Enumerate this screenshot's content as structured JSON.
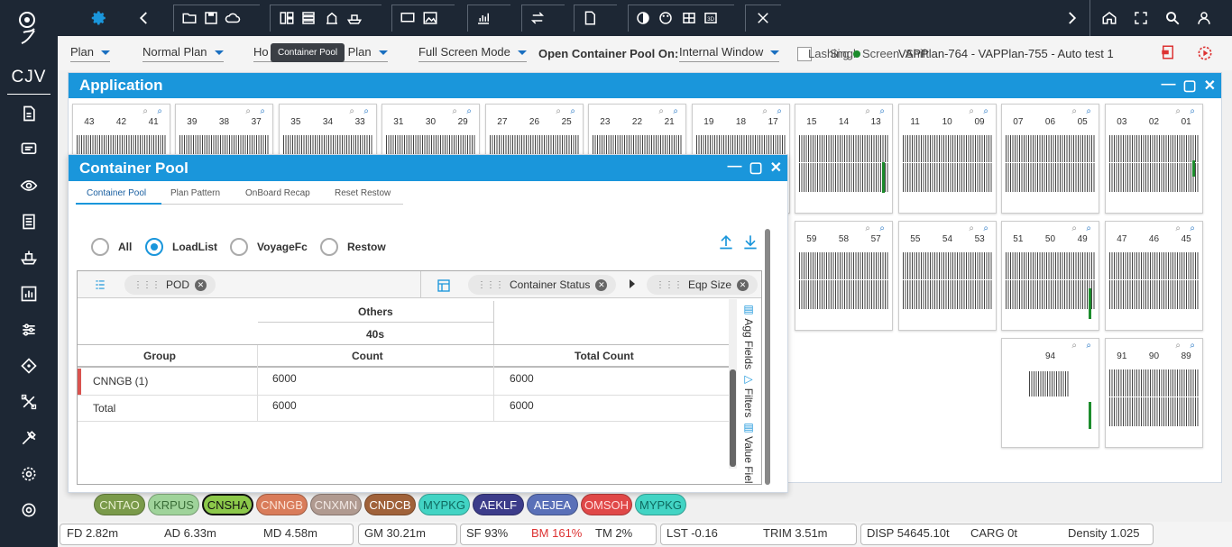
{
  "nav": {
    "brand": "CJV"
  },
  "toolbar": {
    "plan": "Plan",
    "plan_type": "Normal Plan",
    "hold_prefix": "Ho",
    "plan_suffix": "Plan",
    "screen_mode": "Full Screen Mode",
    "open_pool_label": "Open Container Pool On:",
    "open_pool_value": "Internal Window",
    "lashing_text": "Lashing",
    "single_text": "Singl",
    "screen_text": "Screen",
    "shift_text": "Shift",
    "voyage_info": "VAPPlan-764 - VAPPlan-755 - Auto test 1",
    "tooltip": "Container Pool"
  },
  "app": {
    "title": "Application"
  },
  "bays_top": [
    {
      "nums": [
        "43",
        "42",
        "41"
      ]
    },
    {
      "nums": [
        "39",
        "38",
        "37"
      ]
    },
    {
      "nums": [
        "35",
        "34",
        "33"
      ]
    },
    {
      "nums": [
        "31",
        "30",
        "29"
      ]
    },
    {
      "nums": [
        "27",
        "26",
        "25"
      ]
    },
    {
      "nums": [
        "23",
        "22",
        "21"
      ]
    },
    {
      "nums": [
        "19",
        "18",
        "17"
      ]
    },
    {
      "nums": [
        "15",
        "14",
        "13"
      ]
    },
    {
      "nums": [
        "11",
        "10",
        "09"
      ]
    },
    {
      "nums": [
        "07",
        "06",
        "05"
      ]
    },
    {
      "nums": [
        "03",
        "02",
        "01"
      ]
    }
  ],
  "bays_mid": [
    {
      "nums": [
        "59",
        "58",
        "57"
      ]
    },
    {
      "nums": [
        "55",
        "54",
        "53"
      ]
    },
    {
      "nums": [
        "51",
        "50",
        "49"
      ]
    },
    {
      "nums": [
        "47",
        "46",
        "45"
      ]
    }
  ],
  "bays_bot": [
    {
      "nums": [
        "94"
      ]
    },
    {
      "nums": [
        "91",
        "90",
        "89"
      ]
    }
  ],
  "pool": {
    "title": "Container Pool",
    "tabs": [
      "Container Pool",
      "Plan Pattern",
      "OnBoard Recap",
      "Reset Restow"
    ],
    "radios": [
      "All",
      "LoadList",
      "VoyageFc",
      "Restow"
    ],
    "selected": "LoadList",
    "row_chip": "POD",
    "col_chips": [
      "Container Status",
      "Eqp Size"
    ],
    "col_group": "Others",
    "col_sub": "40s",
    "headers": [
      "Group",
      "Count",
      "Total Count"
    ],
    "rows": [
      {
        "group": "CNNGB (1)",
        "count": "6000",
        "total": "6000"
      },
      {
        "group": "Total",
        "count": "6000",
        "total": "6000"
      }
    ],
    "side_labels": [
      "Agg Fields",
      "Filters",
      "Value Fiel"
    ]
  },
  "ports": [
    {
      "code": "CNTAO",
      "bg": "#7a9a4a",
      "fg": "#e8f0d0"
    },
    {
      "code": "KRPUS",
      "bg": "#9fd39a",
      "fg": "#3a6e38"
    },
    {
      "code": "CNSHA",
      "bg": "#8cc84a",
      "fg": "#111111"
    },
    {
      "code": "CNNGB",
      "bg": "#d97c5a",
      "fg": "#fbe3d6"
    },
    {
      "code": "CNXMN",
      "bg": "#b09a90",
      "fg": "#f2e8e4"
    },
    {
      "code": "CNDCB",
      "bg": "#a0623a",
      "fg": "#ffffff"
    },
    {
      "code": "MYPKG",
      "bg": "#42d4c4",
      "fg": "#0e6a60"
    },
    {
      "code": "AEKLF",
      "bg": "#3c3c8a",
      "fg": "#ffffff"
    },
    {
      "code": "AEJEA",
      "bg": "#5a70b8",
      "fg": "#ffffff"
    },
    {
      "code": "OMSOH",
      "bg": "#e04848",
      "fg": "#ffdede"
    },
    {
      "code": "MYPKG",
      "bg": "#42d4c4",
      "fg": "#0e6a60"
    }
  ],
  "status": {
    "fd": "FD 2.82m",
    "ad": "AD 6.33m",
    "md": "MD 4.58m",
    "gm": "GM 30.21m",
    "sf": "SF 93%",
    "bm": "BM 161%",
    "tm": "TM 2%",
    "lst": "LST -0.16",
    "trim": "TRIM 3.51m",
    "disp": "DISP 54645.10t",
    "carg": "CARG 0t",
    "density": "Density 1.025"
  }
}
